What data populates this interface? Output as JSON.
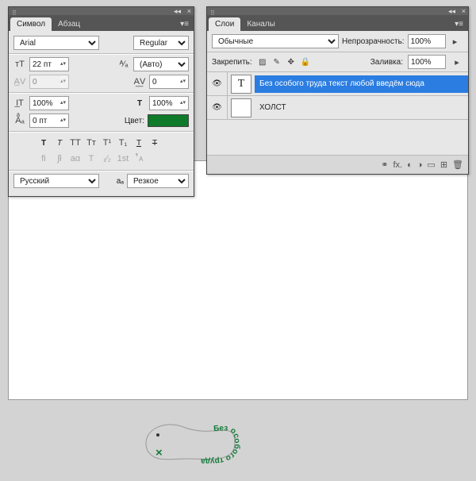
{
  "sym_panel": {
    "tab1": "Символ",
    "tab2": "Абзац",
    "font": "Arial",
    "style": "Regular",
    "size": "22 пт",
    "leading": "(Авто)",
    "av_left": "0",
    "av_right": "0",
    "scale_v": "100%",
    "scale_h": "100%",
    "baseline": "0 пт",
    "color_label": "Цвет:",
    "color": "#0e7a2a",
    "lang": "Русский",
    "aa_label": "aₐ",
    "aa": "Резкое"
  },
  "lay_panel": {
    "tab1": "Слои",
    "tab2": "Каналы",
    "blend": "Обычные",
    "opacity_label": "Непрозрачность:",
    "opacity": "100%",
    "lock_label": "Закрепить:",
    "fill_label": "Заливка:",
    "fill": "100%",
    "layers": [
      {
        "thumb": "T",
        "name": "Без особого труда текст любой введём сюда",
        "selected": true
      },
      {
        "thumb": "",
        "name": "ХОЛСТ",
        "selected": false
      }
    ]
  },
  "canvas": {
    "text": "Без особого труда"
  }
}
